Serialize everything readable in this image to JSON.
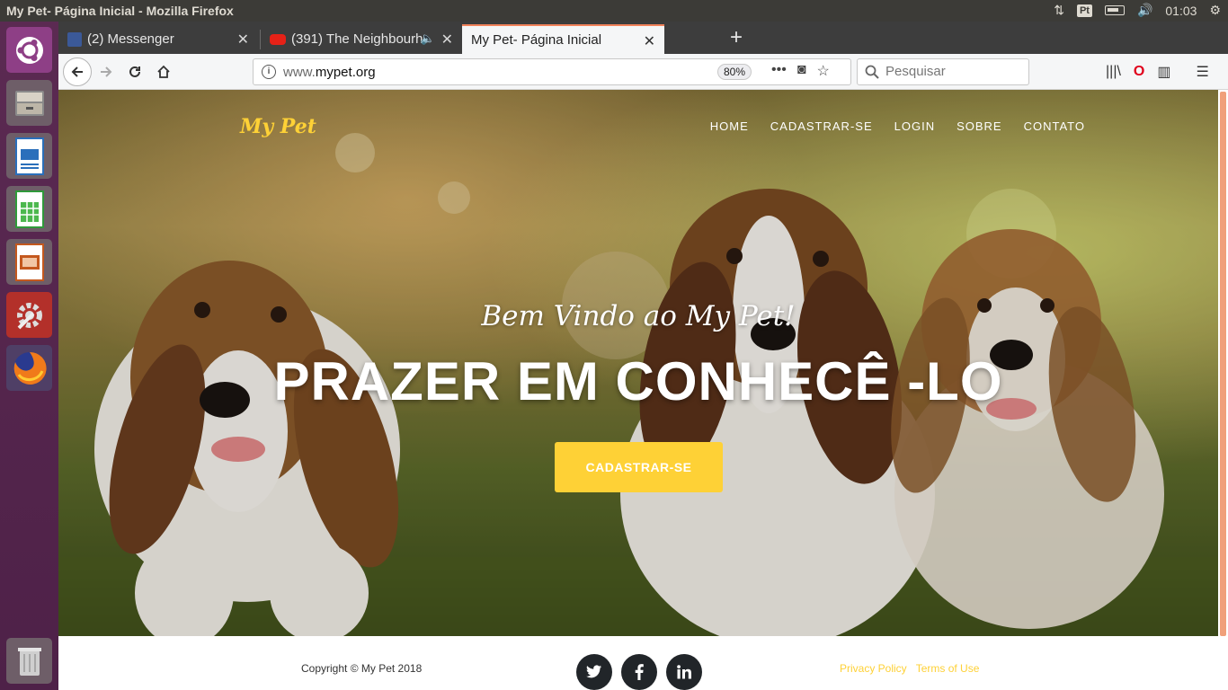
{
  "system": {
    "window_title": "My Pet- Página Inicial - Mozilla Firefox",
    "clock": "01:03",
    "tray_badge": "Pt"
  },
  "launcher": {
    "items": [
      "ubuntu-dash-icon",
      "files-icon",
      "writer-icon",
      "calc-icon",
      "impress-icon",
      "settings-icon",
      "firefox-icon",
      "trash-icon"
    ]
  },
  "tabs": [
    {
      "label": "(2) Messenger",
      "icon": "messenger-icon"
    },
    {
      "label": "(391) The Neighbourh",
      "icon": "youtube-icon"
    },
    {
      "label": "My Pet- Página Inicial",
      "icon": ""
    }
  ],
  "toolbar": {
    "url_prefix": "www.",
    "url_domain": "mypet.org",
    "zoom": "80%",
    "search_placeholder": "Pesquisar"
  },
  "site": {
    "brand": "My Pet",
    "nav": [
      "HOME",
      "CADASTRAR-SE",
      "LOGIN",
      "SOBRE",
      "CONTATO"
    ],
    "welcome": "Bem Vindo ao My Pet!",
    "headline": "PRAZER EM CONHECÊ -LO",
    "cta": "CADASTRAR-SE",
    "colors": {
      "accent": "#fed136",
      "dark": "#212529"
    }
  },
  "footer": {
    "copyright": "Copyright © My Pet 2018",
    "social": [
      "twitter-icon",
      "facebook-icon",
      "linkedin-icon"
    ],
    "privacy": "Privacy Policy",
    "terms": "Terms of Use"
  }
}
